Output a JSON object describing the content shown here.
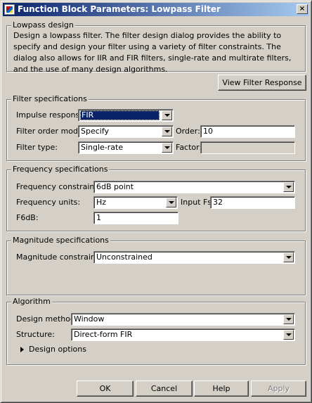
{
  "window": {
    "title": "Function Block Parameters: Lowpass Filter",
    "close_glyph": "×"
  },
  "lowpass": {
    "legend": "Lowpass design",
    "description": "Design a lowpass filter.  The filter design dialog provides the ability to specify and design your filter using a variety of filter constraints.  The dialog also allows for IIR and FIR filters, single-rate and multirate filters, and the use of many design algorithms."
  },
  "view_filter_response": "View Filter Response",
  "filter_specs": {
    "legend": "Filter specifications",
    "impulse_label": "Impulse response:",
    "impulse_value": "FIR",
    "order_mode_label": "Filter order mode:",
    "order_mode_value": "Specify",
    "order_label": "Order:",
    "order_value": "10",
    "filter_type_label": "Filter type:",
    "filter_type_value": "Single-rate",
    "factor_label": "Factor:",
    "factor_value": ""
  },
  "freq_specs": {
    "legend": "Frequency specifications",
    "constraints_label": "Frequency constraints:",
    "constraints_value": "6dB point",
    "units_label": "Frequency units:",
    "units_value": "Hz",
    "input_fs_label": "Input Fs:",
    "input_fs_value": "32",
    "f6db_label": "F6dB:",
    "f6db_value": "1"
  },
  "mag_specs": {
    "legend": "Magnitude specifications",
    "constraints_label": "Magnitude constraints:",
    "constraints_value": "Unconstrained"
  },
  "algorithm": {
    "legend": "Algorithm",
    "method_label": "Design method:",
    "method_value": "Window",
    "structure_label": "Structure:",
    "structure_value": "Direct-form FIR",
    "design_options": "Design options"
  },
  "buttons": {
    "ok": "OK",
    "cancel": "Cancel",
    "help": "Help",
    "apply": "Apply"
  },
  "icons": {
    "app": "simulink-block-icon",
    "dropdown": "chevron-down-icon",
    "expand": "triangle-right-icon"
  }
}
